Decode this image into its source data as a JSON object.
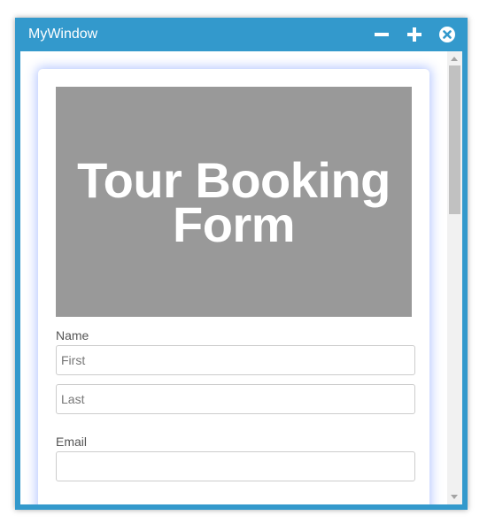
{
  "window": {
    "title": "MyWindow",
    "controls": {
      "minimize_icon": "minus-icon",
      "maximize_icon": "plus-icon",
      "close_icon": "close-circle-icon"
    },
    "colors": {
      "frame": "#3399cc",
      "hero": "#999999"
    }
  },
  "form": {
    "heading": "Tour Booking Form",
    "name_label": "Name",
    "first_placeholder": "First",
    "last_placeholder": "Last",
    "email_label": "Email",
    "email_placeholder": ""
  }
}
